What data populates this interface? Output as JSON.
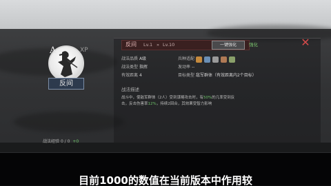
{
  "hero": {
    "rank_letter": "A",
    "rank_suffix": "XP",
    "name": "反间"
  },
  "header": {
    "name": "反间",
    "level_current": "Lv.1",
    "arrow": "»",
    "level_max": "Lv.10",
    "button_label": "一键强化",
    "link_label": "强化"
  },
  "stats": {
    "row1": [
      {
        "label": "战法品质",
        "value": "A级"
      },
      {
        "label": "兵种适配",
        "value": ""
      }
    ],
    "row2": [
      {
        "label": "战法类型",
        "value": "指挥"
      },
      {
        "label": "发动率",
        "value": "--"
      }
    ],
    "row3": [
      {
        "label": "有效距离",
        "value": "4"
      },
      {
        "label": "目标类型",
        "value": "敌军群体（有效距离内2个目标）"
      }
    ]
  },
  "section_title": "战法描述",
  "description": {
    "line1": "战斗中，使敌军群体（2人）受到谋略攻击时，有",
    "line1_highlight": "50%",
    "line1_tail": "的几率受到反",
    "line2": "击，反击伤害率",
    "line2_highlight": "12%",
    "line2_tail": "，持续2回合，其效果受智力影响"
  },
  "footer": {
    "label": "战法经验",
    "value": "0 / 0",
    "gain": "+0"
  },
  "subtitle": "目前1000的数值在当前版本中作用较"
}
